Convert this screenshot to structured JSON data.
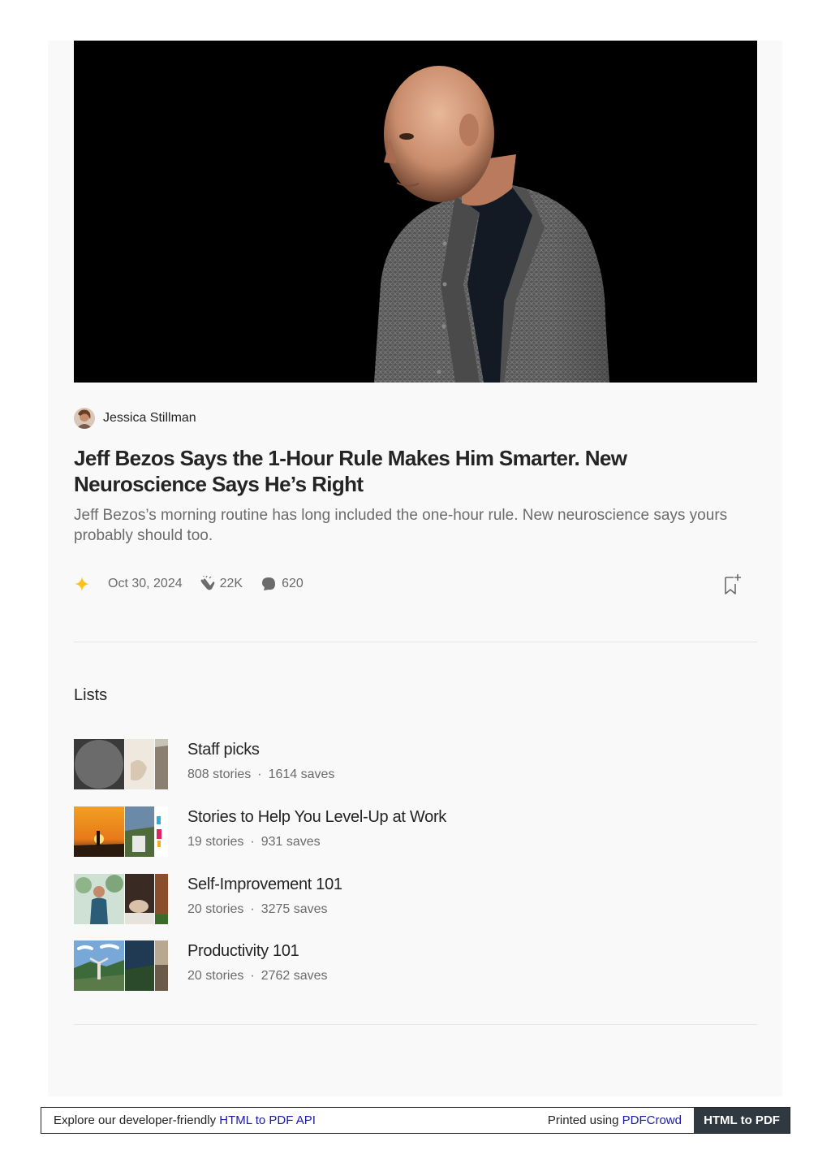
{
  "article": {
    "author": "Jessica Stillman",
    "title": "Jeff Bezos Says the 1-Hour Rule Makes Him Smarter. New Neuroscience Says He’s Right",
    "subtitle": "Jeff Bezos’s morning routine has long included the one-hour rule. New neuroscience says yours probably should too.",
    "date": "Oct 30, 2024",
    "claps": "22K",
    "comments": "620",
    "member_star_color": "#ffc017"
  },
  "lists": {
    "heading": "Lists",
    "items": [
      {
        "title": "Staff picks",
        "stories": "808 stories",
        "saves": "1614 saves"
      },
      {
        "title": "Stories to Help You Level-Up at Work",
        "stories": "19 stories",
        "saves": "931 saves"
      },
      {
        "title": "Self-Improvement 101",
        "stories": "20 stories",
        "saves": "3275 saves"
      },
      {
        "title": "Productivity 101",
        "stories": "20 stories",
        "saves": "2762 saves"
      }
    ]
  },
  "footer": {
    "left_text": "Explore our developer-friendly ",
    "left_link": "HTML to PDF API",
    "right_text": "Printed using ",
    "right_link": "PDFCrowd",
    "button": "HTML to PDF"
  }
}
